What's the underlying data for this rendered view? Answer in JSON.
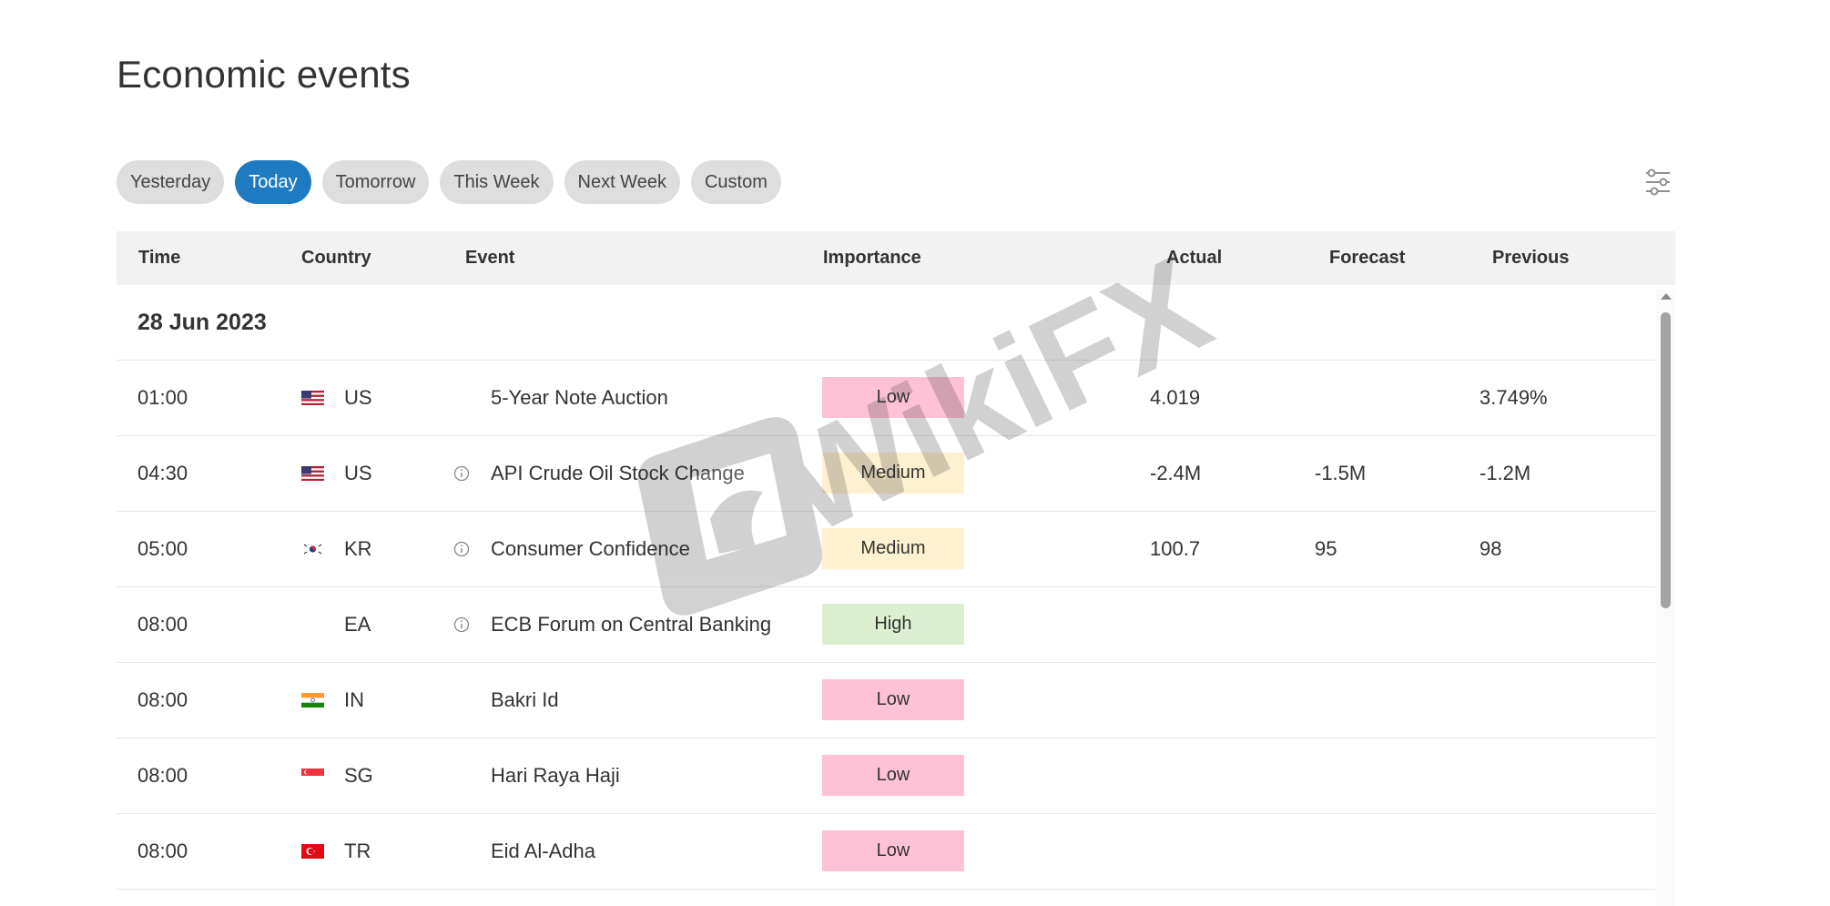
{
  "page": {
    "title": "Economic events"
  },
  "tabs": [
    {
      "label": "Yesterday",
      "active": false
    },
    {
      "label": "Today",
      "active": true
    },
    {
      "label": "Tomorrow",
      "active": false
    },
    {
      "label": "This Week",
      "active": false
    },
    {
      "label": "Next Week",
      "active": false
    },
    {
      "label": "Custom",
      "active": false
    }
  ],
  "toolbar": {
    "filter_icon": "sliders-filter-icon"
  },
  "table": {
    "columns": {
      "time": "Time",
      "country": "Country",
      "event": "Event",
      "importance": "Importance",
      "actual": "Actual",
      "forecast": "Forecast",
      "previous": "Previous"
    },
    "date": "28 Jun 2023",
    "rows": [
      {
        "time": "01:00",
        "flag": "us",
        "country": "US",
        "info": false,
        "event": "5-Year Note Auction",
        "importance": "Low",
        "actual": "4.019",
        "forecast": "",
        "previous": "3.749%"
      },
      {
        "time": "04:30",
        "flag": "us",
        "country": "US",
        "info": true,
        "event": "API Crude Oil Stock Change",
        "importance": "Medium",
        "actual": "-2.4M",
        "forecast": "-1.5M",
        "previous": "-1.2M"
      },
      {
        "time": "05:00",
        "flag": "kr",
        "country": "KR",
        "info": true,
        "event": "Consumer Confidence",
        "importance": "Medium",
        "actual": "100.7",
        "forecast": "95",
        "previous": "98"
      },
      {
        "time": "08:00",
        "flag": "none",
        "country": "EA",
        "info": true,
        "event": "ECB Forum on Central Banking",
        "importance": "High",
        "actual": "",
        "forecast": "",
        "previous": ""
      },
      {
        "time": "08:00",
        "flag": "in",
        "country": "IN",
        "info": false,
        "event": "Bakri Id",
        "importance": "Low",
        "actual": "",
        "forecast": "",
        "previous": ""
      },
      {
        "time": "08:00",
        "flag": "sg",
        "country": "SG",
        "info": false,
        "event": "Hari Raya Haji",
        "importance": "Low",
        "actual": "",
        "forecast": "",
        "previous": ""
      },
      {
        "time": "08:00",
        "flag": "tr",
        "country": "TR",
        "info": false,
        "event": "Eid Al-Adha",
        "importance": "Low",
        "actual": "",
        "forecast": "",
        "previous": ""
      }
    ]
  },
  "importance_colors": {
    "Low": "#ffc1d6",
    "Medium": "#fdf1cf",
    "High": "#dcefd0"
  },
  "colors": {
    "accent": "#1f7bc1",
    "tab_inactive": "#dedede",
    "header_bg": "#f2f2f2"
  },
  "watermark": {
    "text": "WikiFX"
  }
}
